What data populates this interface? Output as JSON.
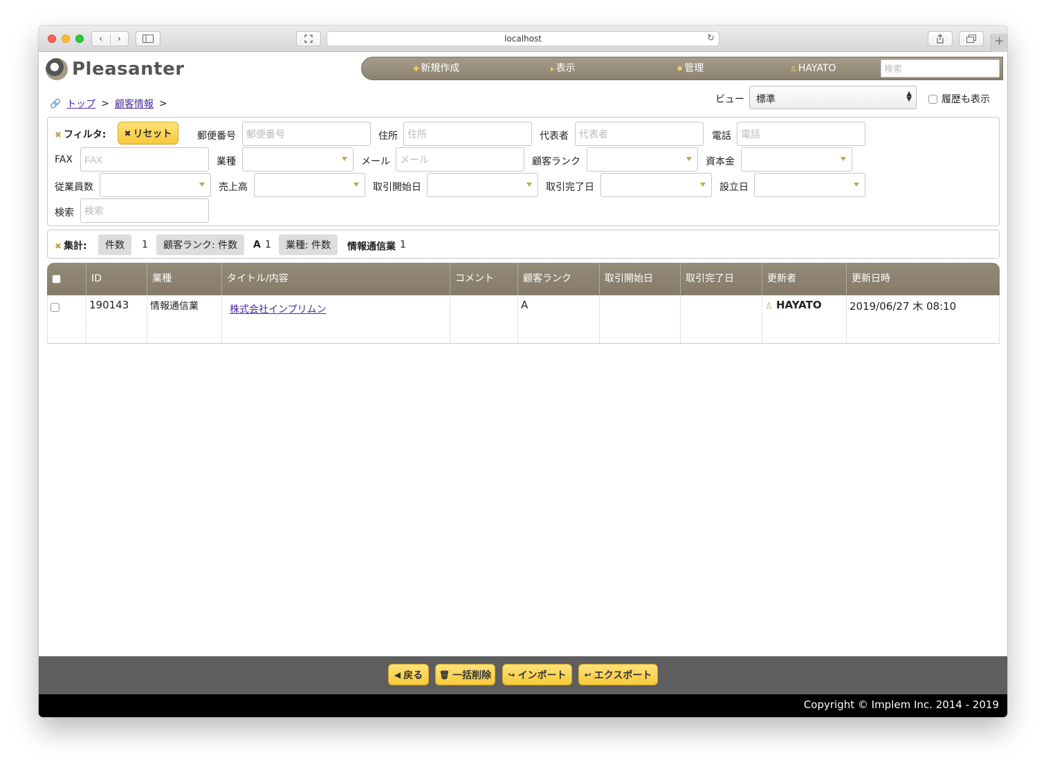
{
  "browser": {
    "url": "localhost",
    "nav_back": "‹",
    "nav_forward": "›"
  },
  "app": {
    "logo_text": "Pleasanter"
  },
  "mainnav": {
    "new_label": "新規作成",
    "view_label": "表示",
    "manage_label": "管理",
    "user_label": "HAYATO",
    "search_placeholder": "検索"
  },
  "breadcrumb": {
    "top": "トップ",
    "customer": "顧客情報",
    "sep": ">"
  },
  "view": {
    "label": "ビュー",
    "selected": "標準",
    "history_label": "履歴も表示"
  },
  "filter": {
    "title": "フィルタ:",
    "reset_label": "リセット",
    "fields": {
      "postal_label": "郵便番号",
      "postal_placeholder": "郵便番号",
      "address_label": "住所",
      "address_placeholder": "住所",
      "rep_label": "代表者",
      "rep_placeholder": "代表者",
      "phone_label": "電話",
      "phone_placeholder": "電話",
      "fax_label": "FAX",
      "fax_placeholder": "FAX",
      "industry_label": "業種",
      "mail_label": "メール",
      "mail_placeholder": "メール",
      "rank_label": "顧客ランク",
      "capital_label": "資本金",
      "employees_label": "従業員数",
      "sales_label": "売上高",
      "start_label": "取引開始日",
      "end_label": "取引完了日",
      "founded_label": "設立日",
      "search_label": "検索",
      "search_placeholder": "検索"
    }
  },
  "aggregate": {
    "title": "集計:",
    "count_label": "件数",
    "count_value": "1",
    "rank_label": "顧客ランク: 件数",
    "rank_key": "A",
    "rank_value": "1",
    "industry_label": "業種: 件数",
    "industry_key": "情報通信業",
    "industry_value": "1"
  },
  "grid": {
    "columns": [
      "ID",
      "業種",
      "タイトル/内容",
      "コメント",
      "顧客ランク",
      "取引開始日",
      "取引完了日",
      "更新者",
      "更新日時"
    ],
    "rows": [
      {
        "id": "190143",
        "industry": "情報通信業",
        "title": "株式会社インプリムン",
        "comment": "",
        "rank": "A",
        "start": "",
        "end": "",
        "updater": "HAYATO",
        "updated": "2019/06/27 木 08:10"
      }
    ]
  },
  "footer": {
    "back_label": "戻る",
    "bulk_delete_label": "一括削除",
    "import_label": "インポート",
    "export_label": "エクスポート",
    "copyright": "Copyright © Implem Inc. 2014 - 2019"
  },
  "colors": {
    "accent_yellow": "#f6c93a",
    "nav_brown": "#948a78",
    "link_purple": "#4b2aa0"
  }
}
